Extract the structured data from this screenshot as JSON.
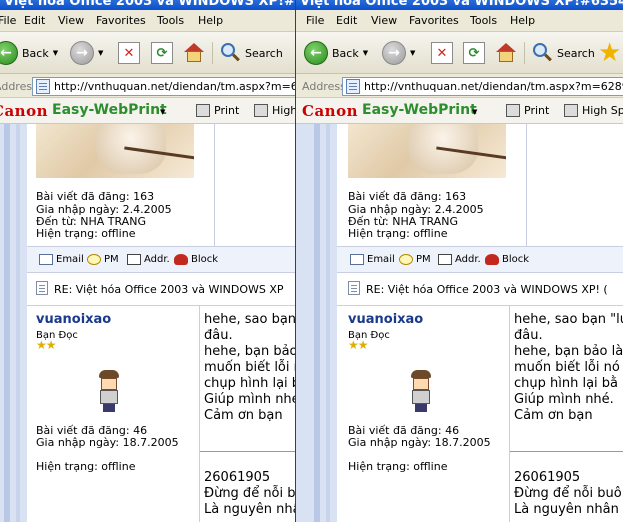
{
  "windows": [
    {
      "title": "Việt hóa Office 2003 và WINDOWS XP!#63546 -",
      "menu": [
        "File",
        "Edit",
        "View",
        "Favorites",
        "Tools",
        "Help"
      ],
      "toolbar": {
        "back_label": "Back",
        "search_label": "Search"
      },
      "address": {
        "label": "Address",
        "url": "http://vnthuquan.net/diendan/tm.aspx?m=62892"
      },
      "canon": {
        "logo": "Canon",
        "app": "Easy-WebPrint",
        "print": "Print",
        "high": "High"
      },
      "post1": {
        "stats": [
          "Bài viết đã đăng: 163",
          "Gia nhập ngày: 2.4.2005",
          "Đến từ: NHA TRANG",
          "Hiện trạng: offline"
        ],
        "actions": {
          "email": "Email",
          "pm": "PM",
          "addr": "Addr.",
          "block": "Block"
        }
      },
      "reply_subject": "RE: Việt hóa Office 2003 và WINDOWS XP",
      "post2": {
        "author": "vuanoixao",
        "rank": "Bạn Đọc",
        "stats": [
          "Bài viết đã đăng: 46",
          "Gia nhập ngày: 18.7.2005"
        ],
        "status": "Hiện trạng: offline",
        "message": [
          "hehe, sao bạn",
          "đâu.",
          "hehe, bạn bảo",
          "muốn biết lỗi n",
          "chụp hình lại b",
          "Giúp mình nhé",
          "Cảm ơn bạn"
        ],
        "signature": [
          "26061905",
          "Đừng để nỗi bu",
          "Là nguyên nhâ"
        ]
      }
    },
    {
      "title": "Việt hóa Office 2003 và WINDOWS XP!#63546 - M",
      "menu": [
        "File",
        "Edit",
        "View",
        "Favorites",
        "Tools",
        "Help"
      ],
      "toolbar": {
        "back_label": "Back",
        "search_label": "Search"
      },
      "address": {
        "label": "Address",
        "url": "http://vnthuquan.net/diendan/tm.aspx?m=628928m"
      },
      "canon": {
        "logo": "Canon",
        "app": "Easy-WebPrint",
        "print": "Print",
        "high": "High Spe"
      },
      "post1": {
        "stats": [
          "Bài viết đã đăng: 163",
          "Gia nhập ngày: 2.4.2005",
          "Đến từ: NHA TRANG",
          "Hiện trạng: offline"
        ],
        "actions": {
          "email": "Email",
          "pm": "PM",
          "addr": "Addr.",
          "block": "Block"
        }
      },
      "reply_subject": "RE: Việt hóa Office 2003 và WINDOWS XP! (",
      "post2": {
        "author": "vuanoixao",
        "rank": "Bạn Đọc",
        "stats": [
          "Bài viết đã đăng: 46",
          "Gia nhập ngày: 18.7.2005"
        ],
        "status": "Hiện trạng: offline",
        "message": [
          "hehe, sao bạn \"lu",
          "đâu.",
          "hehe, bạn bảo là",
          "muốn biết lỗi nó",
          "chụp hình lại bằ",
          "Giúp mình nhé.",
          "Cảm ơn bạn"
        ],
        "signature": [
          "26061905",
          "Đừng để nỗi buô",
          "Là nguyên nhân"
        ]
      }
    }
  ],
  "icons": [
    "back-arrow-icon",
    "forward-arrow-icon",
    "stop-icon",
    "refresh-icon",
    "home-icon",
    "search-icon",
    "favorites-star-icon",
    "page-icon",
    "print-icon",
    "email-icon",
    "pm-icon",
    "addr-icon",
    "block-icon"
  ],
  "colors": {
    "canon_red": "#cc0000",
    "easywebprint_green": "#2c8e2c",
    "author_blue": "#1a3a8c",
    "star_gold": "#e0b000",
    "titlebar_blue": "#0a4fce"
  }
}
